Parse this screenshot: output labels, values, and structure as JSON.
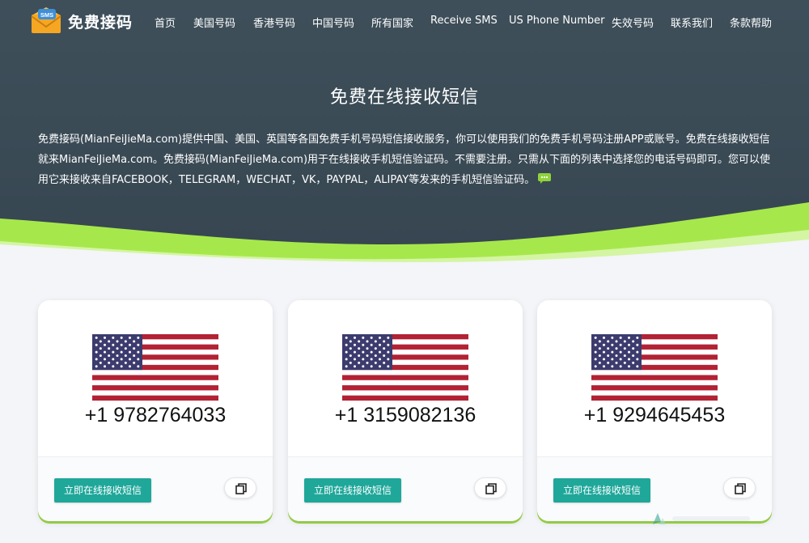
{
  "nav": {
    "brand_name": "免费接码",
    "logo_badge": "SMS",
    "logo_icon": "envelope-sms-icon",
    "links": [
      {
        "label": "首页"
      },
      {
        "label": "美国号码"
      },
      {
        "label": "香港号码"
      },
      {
        "label": "中国号码"
      },
      {
        "label": "所有国家"
      },
      {
        "label": "Receive SMS"
      },
      {
        "label": "US Phone Number"
      },
      {
        "label": "失效号码"
      },
      {
        "label": "联系我们"
      },
      {
        "label": "条款帮助"
      }
    ]
  },
  "hero": {
    "title": "免费在线接收短信",
    "description": "免费接码(MianFeiJieMa.com)提供中国、美国、英国等各国免费手机号码短信接收服务，你可以使用我们的免费手机号码注册APP或账号。免费在线接收短信就来MianFeiJieMa.com。免费接码(MianFeiJieMa.com)用于在线接收手机短信验证码。不需要注册。只需从下面的列表中选择您的电话号码即可。您可以使用它来接收来自FACEBOOK，TELEGRAM，WECHAT，VK，PAYPAL，ALIPAY等发来的手机短信验证码。",
    "chat_icon": "chat-bubble-icon"
  },
  "cards": [
    {
      "flag": "us-flag-icon",
      "number": "+1 9782764033",
      "button_label": "立即在线接收短信",
      "copy_icon": "copy-icon"
    },
    {
      "flag": "us-flag-icon",
      "number": "+1 3159082136",
      "button_label": "立即在线接收短信",
      "copy_icon": "copy-icon"
    },
    {
      "flag": "us-flag-icon",
      "number": "+1 9294645453",
      "button_label": "立即在线接收短信",
      "copy_icon": "copy-icon"
    }
  ],
  "colors": {
    "hero_bg": "#3e4f5a",
    "wave_green": "#a6e84b",
    "button_teal": "#1fa79a",
    "flag_red": "#b22234",
    "flag_blue": "#3c3b6e"
  }
}
